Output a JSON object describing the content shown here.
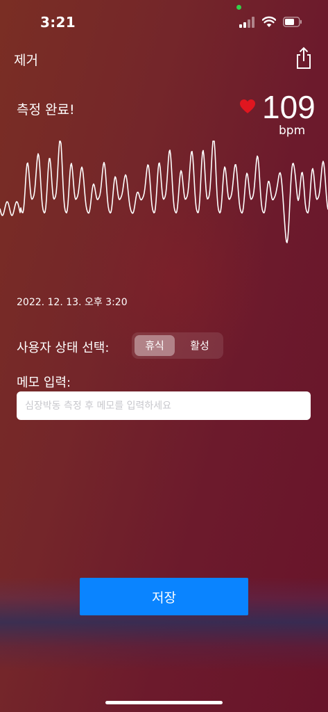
{
  "status_bar": {
    "time": "3:21"
  },
  "nav": {
    "remove_label": "제거"
  },
  "measurement": {
    "status_label": "측정 완료!",
    "bpm": "109",
    "unit": "bpm",
    "timestamp": "2022. 12. 13. 오후 3:20"
  },
  "user_state": {
    "label": "사용자 상태 선택:",
    "options": [
      "휴식",
      "활성"
    ],
    "selected": "휴식"
  },
  "memo": {
    "label": "메모 입력:",
    "placeholder": "심장박동 측정 후 메모를 입력하세요",
    "value": ""
  },
  "actions": {
    "save_label": "저장"
  },
  "colors": {
    "accent": "#0a84ff",
    "heart": "#e0161f",
    "camera_indicator": "#33d04a"
  }
}
